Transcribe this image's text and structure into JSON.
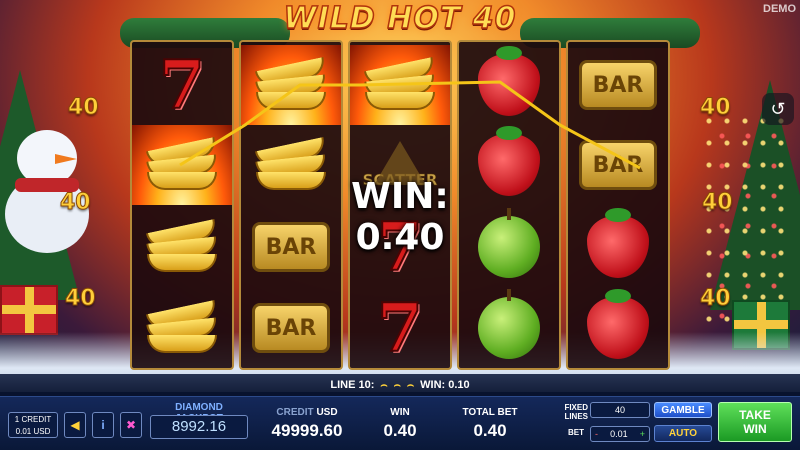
{
  "header": {
    "title": "WILD HOT 40",
    "mode": "DEMO"
  },
  "paylines": {
    "left": [
      "40",
      "40",
      "40"
    ],
    "right": [
      "40",
      "40",
      "40"
    ]
  },
  "reels": [
    [
      "seven",
      "banana-fire",
      "banana",
      "banana"
    ],
    [
      "banana-fire",
      "banana",
      "bar",
      "bar"
    ],
    [
      "banana-fire",
      "scatter",
      "seven",
      "seven"
    ],
    [
      "strawberry",
      "strawberry",
      "apple",
      "apple"
    ],
    [
      "bar",
      "bar",
      "strawberry",
      "strawberry"
    ]
  ],
  "symbols": {
    "seven": "7",
    "bar": "BAR",
    "scatter": "SCATTER"
  },
  "win_overlay": "WIN: 0.40",
  "info_line": {
    "line": "LINE 10:",
    "win": "WIN: 0.10"
  },
  "panel": {
    "credit_unit_1": "1 CREDIT",
    "credit_unit_2": "0.01 USD",
    "jackpot_label": "DIAMOND JACKPOT",
    "jackpot_value": "8992.16",
    "credit_label": "CREDIT",
    "credit_currency": "USD",
    "credit_value": "49999.60",
    "win_label": "WIN",
    "win_value": "0.40",
    "total_bet_label": "TOTAL BET",
    "total_bet_value": "0.40",
    "fixed_lines_label_1": "FIXED",
    "fixed_lines_label_2": "LINES",
    "fixed_lines_value": "40",
    "bet_label": "BET",
    "bet_minus": "-",
    "bet_value": "0.01",
    "bet_plus": "+",
    "gamble": "GAMBLE",
    "auto": "AUTO",
    "take_win_1": "TAKE",
    "take_win_2": "WIN"
  },
  "icons": {
    "sound": "sound-icon",
    "info": "info-icon",
    "fullscreen": "fullscreen-icon",
    "history": "history-icon"
  },
  "colors": {
    "accent_gold": "#ffd23a",
    "panel_blue": "#14285a",
    "take_win_green": "#1b9a24",
    "gamble_blue": "#1e4fc8",
    "win_line": "#f5c518"
  }
}
